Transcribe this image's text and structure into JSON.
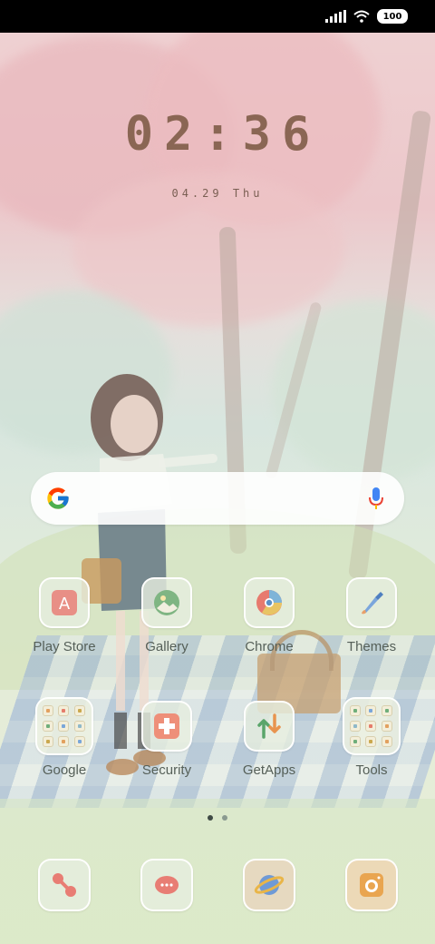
{
  "status_bar": {
    "battery": "100",
    "wifi_icon": "wifi-icon",
    "signal_icon": "signal-icon"
  },
  "clock": {
    "time": "02:36",
    "date": "04.29 Thu"
  },
  "search": {
    "logo": "G",
    "mic_icon": "mic-icon"
  },
  "apps_row1": [
    {
      "label": "Play Store",
      "icon": "play-store-icon"
    },
    {
      "label": "Gallery",
      "icon": "gallery-icon"
    },
    {
      "label": "Chrome",
      "icon": "chrome-icon"
    },
    {
      "label": "Themes",
      "icon": "themes-icon"
    }
  ],
  "apps_row2": [
    {
      "label": "Google",
      "icon": "google-folder-icon"
    },
    {
      "label": "Security",
      "icon": "security-icon"
    },
    {
      "label": "GetApps",
      "icon": "getapps-icon"
    },
    {
      "label": "Tools",
      "icon": "tools-folder-icon"
    }
  ],
  "page_indicator": {
    "pages": 2,
    "active": 1
  },
  "dock": [
    {
      "icon": "phone-icon"
    },
    {
      "icon": "messages-icon"
    },
    {
      "icon": "browser-icon"
    },
    {
      "icon": "camera-icon"
    }
  ],
  "colors": {
    "clock": "#8a6654",
    "label": "#555f58",
    "tile_border": "#ffffff"
  }
}
